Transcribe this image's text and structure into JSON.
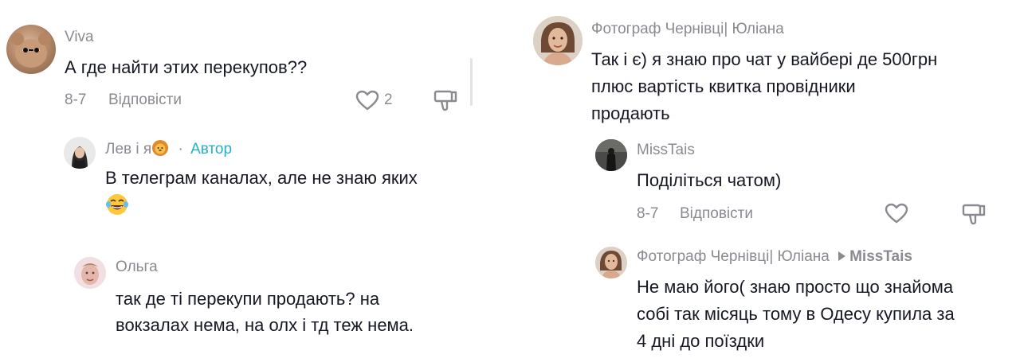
{
  "left": {
    "comment1": {
      "username": "Viva",
      "text": "А где найти этих перекупов??",
      "date": "8-7",
      "reply_label": "Відповісти",
      "like_count": "2"
    },
    "reply1": {
      "username": "Лев і я",
      "author_separator": "·",
      "author_label": "Автор",
      "text": "В телеграм каналах, але не знаю яких"
    },
    "reply2": {
      "username": "Ольга",
      "text_line1": "так де ті перекупи продають? на",
      "text_line2": "вокзалах нема, на олх і тд теж нема."
    }
  },
  "right": {
    "comment1": {
      "username": "Фотограф Чернівці| Юліана",
      "text_line1": "Так і є) я знаю про чат у вайбері де 500грн",
      "text_line2": "плюс вартість квитка провідники",
      "text_line3": "продають"
    },
    "reply1": {
      "username": "MissTais",
      "text": "Поділіться чатом)",
      "date": "8-7",
      "reply_label": "Відповісти"
    },
    "reply2": {
      "username": "Фотограф Чернівці| Юліана",
      "reply_to": "MissTais",
      "text_line1": "Не маю його( знаю просто що знайома",
      "text_line2": "собі так місяць тому в Одесу купила за",
      "text_line3": "4 дні до поїздки"
    }
  },
  "colors": {
    "text": "#161823",
    "secondary": "#8a8b91",
    "author_accent": "#20b3c7"
  },
  "icons": [
    "heart-outline-icon",
    "thumbs-down-icon",
    "play-triangle-icon",
    "lion-emoji-icon",
    "laughing-emoji-icon"
  ]
}
